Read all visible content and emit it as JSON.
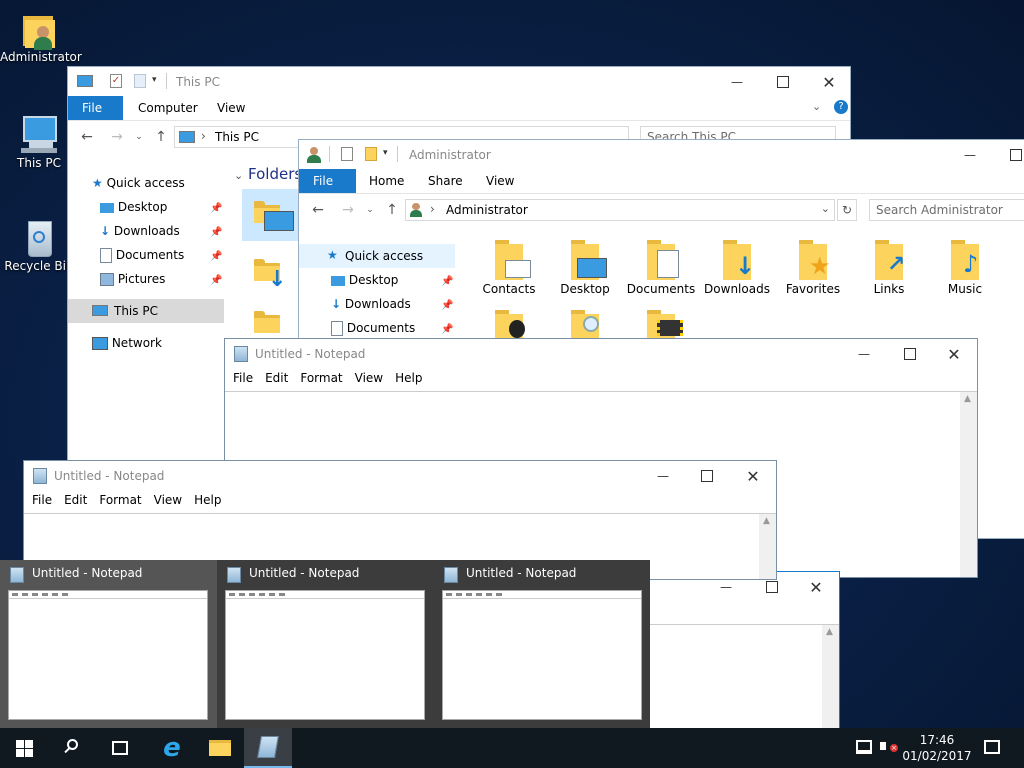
{
  "desktop": {
    "icons": [
      {
        "label": "Administrator",
        "icon": "user-folder-icon"
      },
      {
        "label": "This PC",
        "icon": "computer-icon"
      },
      {
        "label": "Recycle Bin",
        "icon": "recycle-bin-icon"
      }
    ]
  },
  "thispc_window": {
    "title": "This PC",
    "tabs": [
      "File",
      "Computer",
      "View"
    ],
    "address": "This PC",
    "search_placeholder": "Search This PC",
    "section_header": "Folders",
    "nav": {
      "quick_access": "Quick access",
      "items": [
        "Desktop",
        "Downloads",
        "Documents",
        "Pictures"
      ],
      "this_pc": "This PC",
      "network": "Network"
    }
  },
  "admin_window": {
    "title": "Administrator",
    "tabs": [
      "File",
      "Home",
      "Share",
      "View"
    ],
    "address": "Administrator",
    "search_placeholder": "Search Administrator",
    "nav": {
      "quick_access": "Quick access",
      "items": [
        "Desktop",
        "Downloads",
        "Documents"
      ]
    },
    "folders": [
      "Contacts",
      "Desktop",
      "Documents",
      "Downloads",
      "Favorites",
      "Links",
      "Music"
    ]
  },
  "notepad1": {
    "title": "Untitled - Notepad",
    "menu": [
      "File",
      "Edit",
      "Format",
      "View",
      "Help"
    ]
  },
  "notepad2": {
    "title": "Untitled - Notepad",
    "menu": [
      "File",
      "Edit",
      "Format",
      "View",
      "Help"
    ]
  },
  "thumbnails": [
    {
      "title": "Untitled - Notepad"
    },
    {
      "title": "Untitled - Notepad"
    },
    {
      "title": "Untitled - Notepad"
    }
  ],
  "taskbar": {
    "time": "17:46",
    "date": "01/02/2017"
  },
  "colors": {
    "accent": "#1979ca",
    "taskbar": "#101820",
    "folder": "#fcd35c"
  }
}
